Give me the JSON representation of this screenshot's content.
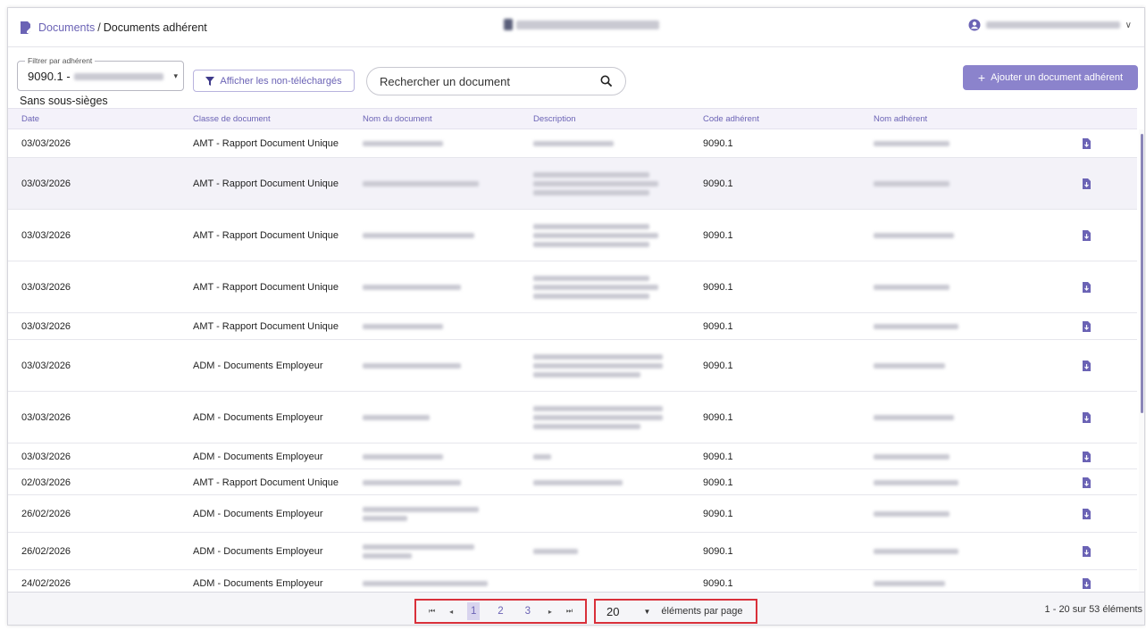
{
  "breadcrumb": {
    "root": "Documents",
    "separator": "/",
    "current": "Documents adhérent"
  },
  "colors": {
    "accent": "#6b63b5",
    "primary_button": "#8b83cc",
    "highlight_frame": "#d9303a"
  },
  "icons": {
    "breadcrumb": "document-icon",
    "user": "user-circle-icon",
    "filter": "funnel-icon",
    "search": "search-icon",
    "add": "plus-icon",
    "row_action": "download-icon"
  },
  "filter": {
    "legend": "Filtrer par adhérent",
    "value_prefix": "9090.1 -"
  },
  "toolbar": {
    "non_downloaded_label": "Afficher les non-téléchargés",
    "search_placeholder": "Rechercher un document",
    "add_label": "Ajouter un document adhérent"
  },
  "section_title": "Sans sous-sièges",
  "table": {
    "columns": [
      "Date",
      "Classe de document",
      "Nom du document",
      "Description",
      "Code adhérent",
      "Nom adhérent"
    ],
    "rows": [
      {
        "date": "03/03/2026",
        "class": "AMT - Rapport Document Unique",
        "code": "9090.1"
      },
      {
        "date": "03/03/2026",
        "class": "AMT - Rapport Document Unique",
        "code": "9090.1"
      },
      {
        "date": "03/03/2026",
        "class": "AMT - Rapport Document Unique",
        "code": "9090.1"
      },
      {
        "date": "03/03/2026",
        "class": "AMT - Rapport Document Unique",
        "code": "9090.1"
      },
      {
        "date": "03/03/2026",
        "class": "AMT - Rapport Document Unique",
        "code": "9090.1"
      },
      {
        "date": "03/03/2026",
        "class": "ADM - Documents Employeur",
        "code": "9090.1"
      },
      {
        "date": "03/03/2026",
        "class": "ADM - Documents Employeur",
        "code": "9090.1"
      },
      {
        "date": "03/03/2026",
        "class": "ADM - Documents Employeur",
        "code": "9090.1"
      },
      {
        "date": "02/03/2026",
        "class": "AMT - Rapport Document Unique",
        "code": "9090.1"
      },
      {
        "date": "26/02/2026",
        "class": "ADM - Documents Employeur",
        "code": "9090.1"
      },
      {
        "date": "26/02/2026",
        "class": "ADM - Documents Employeur",
        "code": "9090.1"
      },
      {
        "date": "24/02/2026",
        "class": "ADM - Documents Employeur",
        "code": "9090.1"
      }
    ]
  },
  "pagination": {
    "first": "⏮",
    "prev": "◂",
    "pages": [
      "1",
      "2",
      "3"
    ],
    "active_page": "1",
    "next": "▸",
    "last": "⏭",
    "page_size": "20",
    "page_size_label": "éléments par page",
    "summary": "1 - 20 sur 53 éléments"
  }
}
